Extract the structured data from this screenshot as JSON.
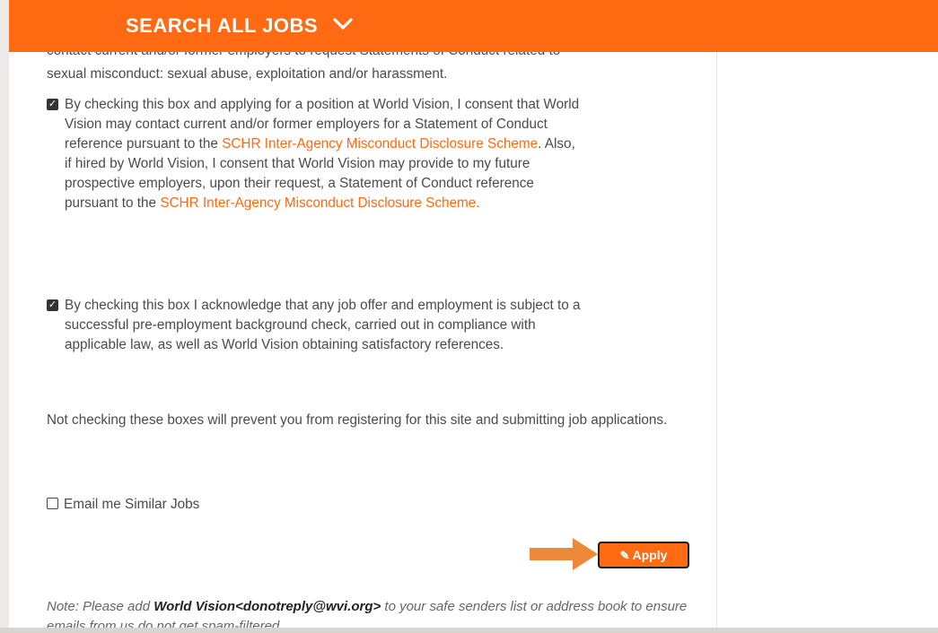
{
  "header": {
    "title": "SEARCH ALL JOBS",
    "chevron_icon": "chevron-down-icon",
    "color": "#ff6a13"
  },
  "content": {
    "cut_line_top": "contact current and/or former employers to request Statements of Conduct related to",
    "cut_line": "sexual misconduct: sexual abuse, exploitation and/or harassment.",
    "consent1": {
      "checked": true,
      "p1": "By checking this box and applying for a position at World Vision, I consent that World Vision may contact current and/or former employers for a Statement of Conduct reference pursuant to the ",
      "link1": "SCHR Inter-Agency Misconduct Disclosure Scheme",
      "p2": ". Also, if hired by World Vision, I consent that World Vision may provide to my future prospective employers, upon their request, a Statement of Conduct reference pursuant to the ",
      "link2": "SCHR Inter-Agency Misconduct Disclosure Scheme",
      "p3": "."
    },
    "consent2": {
      "checked": true,
      "text": "By checking this box I acknowledge that any job offer and employment is subject to a successful pre-employment background check, carried out in compliance with applicable law, as well as World Vision obtaining satisfactory references."
    },
    "warning": "Not checking these boxes will prevent you from registering for this site and submitting job applications.",
    "email_label": "Email me Similar Jobs",
    "email_checked": false,
    "apply_label": "Apply",
    "apply_icon": "edit-icon",
    "note": {
      "prefix": "Note: Please add ",
      "sender": "World Vision<donotreply@wvi.org>",
      "suffix": " to your safe senders list or address book to ensure emails from us do not get spam-filtered."
    }
  },
  "colors": {
    "accent": "#ff6a13",
    "arrow": "#ec8a3a"
  }
}
